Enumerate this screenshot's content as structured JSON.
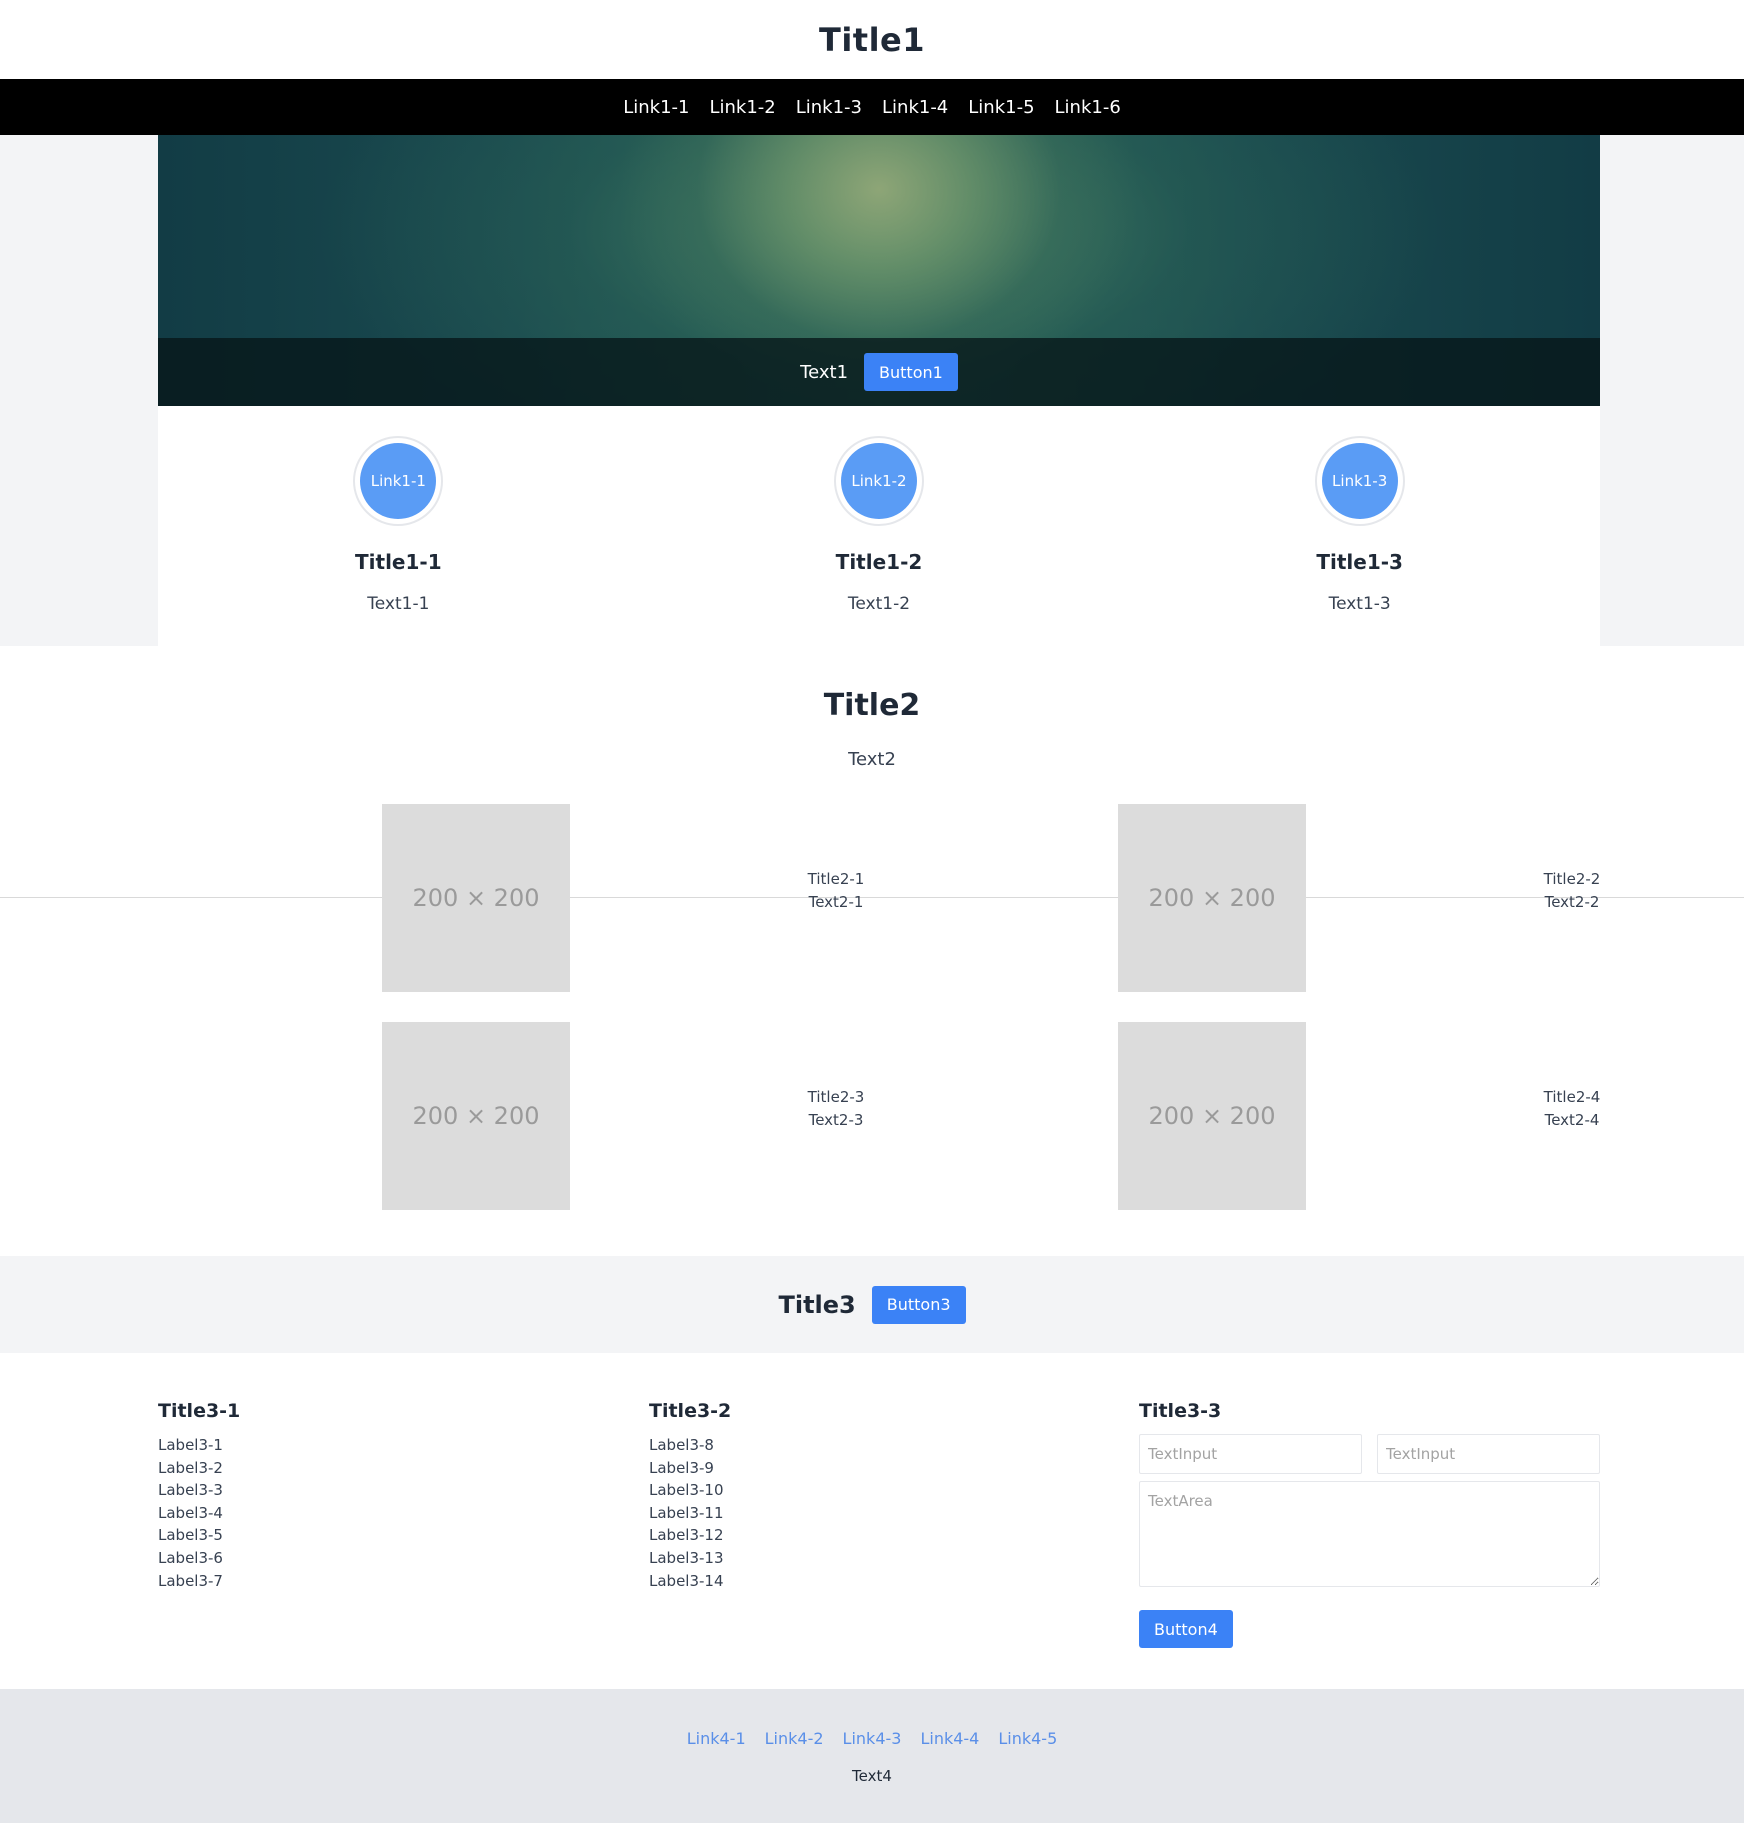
{
  "header": {
    "title": "Title1",
    "nav": [
      "Link1-1",
      "Link1-2",
      "Link1-3",
      "Link1-4",
      "Link1-5",
      "Link1-6"
    ]
  },
  "hero": {
    "text": "Text1",
    "button": "Button1"
  },
  "features": [
    {
      "link": "Link1-1",
      "title": "Title1-1",
      "text": "Text1-1"
    },
    {
      "link": "Link1-2",
      "title": "Title1-2",
      "text": "Text1-2"
    },
    {
      "link": "Link1-3",
      "title": "Title1-3",
      "text": "Text1-3"
    }
  ],
  "section2": {
    "title": "Title2",
    "text": "Text2",
    "items": [
      {
        "placeholder": "200 × 200",
        "title": "Title2-1",
        "text": "Text2-1"
      },
      {
        "placeholder": "200 × 200",
        "title": "Title2-2",
        "text": "Text2-2"
      },
      {
        "placeholder": "200 × 200",
        "title": "Title2-3",
        "text": "Text2-3"
      },
      {
        "placeholder": "200 × 200",
        "title": "Title2-4",
        "text": "Text2-4"
      }
    ]
  },
  "section3": {
    "title": "Title3",
    "button": "Button3",
    "col1": {
      "title": "Title3-1",
      "labels": [
        "Label3-1",
        "Label3-2",
        "Label3-3",
        "Label3-4",
        "Label3-5",
        "Label3-6",
        "Label3-7"
      ]
    },
    "col2": {
      "title": "Title3-2",
      "labels": [
        "Label3-8",
        "Label3-9",
        "Label3-10",
        "Label3-11",
        "Label3-12",
        "Label3-13",
        "Label3-14"
      ]
    },
    "col3": {
      "title": "Title3-3",
      "input1_placeholder": "TextInput",
      "input2_placeholder": "TextInput",
      "textarea_placeholder": "TextArea",
      "button": "Button4"
    }
  },
  "footer": {
    "links": [
      "Link4-1",
      "Link4-2",
      "Link4-3",
      "Link4-4",
      "Link4-5"
    ],
    "text": "Text4"
  },
  "colors": {
    "accent": "#3b82f6",
    "nav_bg": "#000000",
    "band_bg": "#f3f4f6",
    "footer_bg": "#e5e7eb",
    "footer_link": "#5a8fe8",
    "placeholder_tile": "#dcdcdc"
  }
}
